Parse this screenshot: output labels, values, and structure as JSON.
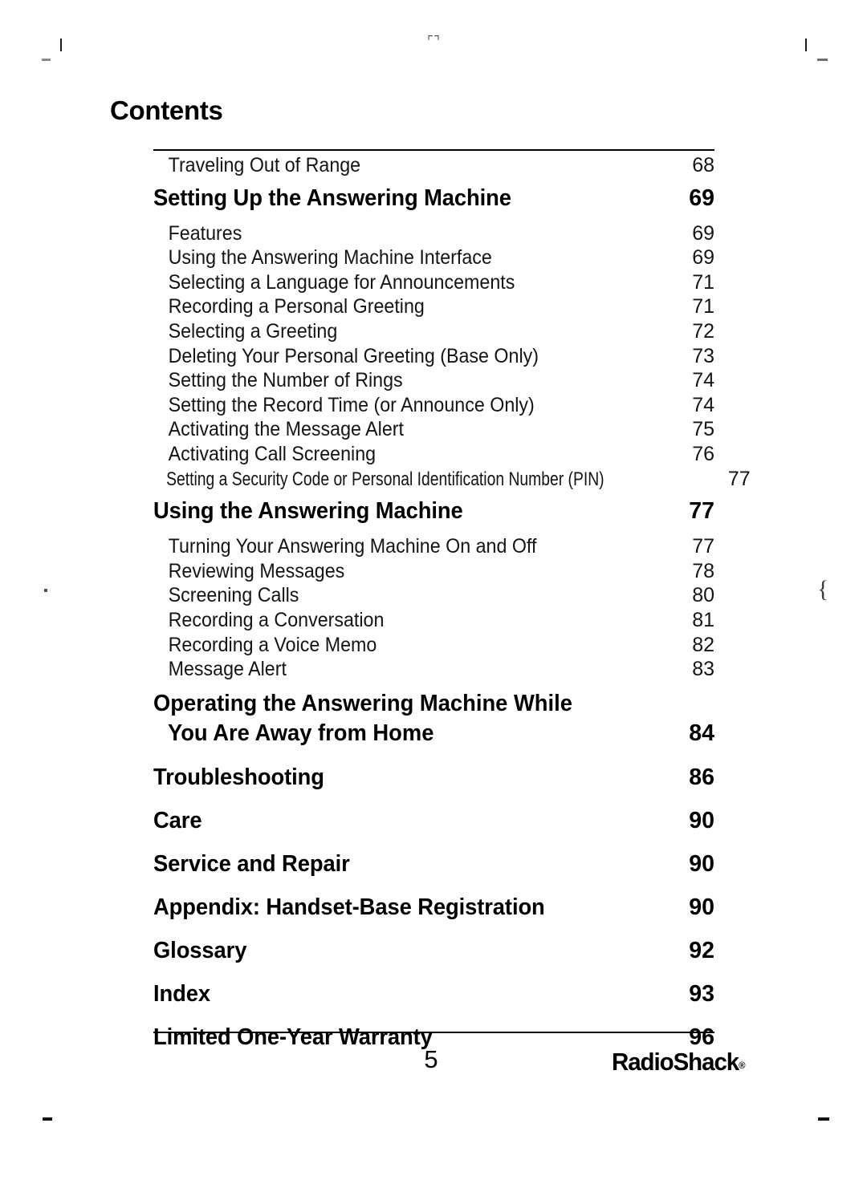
{
  "page": {
    "title": "Contents",
    "page_number": "5",
    "brand": "RadioShack",
    "brand_mark": "®"
  },
  "toc": {
    "entries": [
      {
        "kind": "sub",
        "label": "Traveling Out of Range",
        "page": "68"
      },
      {
        "kind": "head",
        "label": "Setting Up the Answering Machine",
        "page": "69"
      },
      {
        "kind": "sub",
        "label": "Features",
        "page": "69"
      },
      {
        "kind": "sub",
        "label": "Using the Answering Machine Interface",
        "page": "69"
      },
      {
        "kind": "sub",
        "label": "Selecting a Language for Announcements",
        "page": "71"
      },
      {
        "kind": "sub",
        "label": "Recording a Personal Greeting",
        "page": "71"
      },
      {
        "kind": "sub",
        "label": "Selecting a Greeting",
        "page": "72"
      },
      {
        "kind": "sub",
        "label": "Deleting Your Personal Greeting (Base Only)",
        "page": "73"
      },
      {
        "kind": "sub",
        "label": "Setting the Number of Rings",
        "page": "74"
      },
      {
        "kind": "sub",
        "label": "Setting the Record Time (or Announce Only)",
        "page": "74"
      },
      {
        "kind": "sub",
        "label": "Activating the Message Alert",
        "page": "75"
      },
      {
        "kind": "sub",
        "label": "Activating Call Screening",
        "page": "76"
      },
      {
        "kind": "sub-tight",
        "label": "Setting a Security Code or Personal Identification Number (PIN)",
        "page": "77"
      },
      {
        "kind": "head",
        "label": "Using the Answering Machine",
        "page": "77"
      },
      {
        "kind": "sub",
        "label": "Turning Your Answering Machine On and Off",
        "page": "77"
      },
      {
        "kind": "sub",
        "label": "Reviewing Messages",
        "page": "78"
      },
      {
        "kind": "sub",
        "label": "Screening Calls",
        "page": "80"
      },
      {
        "kind": "sub",
        "label": "Recording a Conversation",
        "page": "81"
      },
      {
        "kind": "sub",
        "label": "Recording a Voice Memo",
        "page": "82"
      },
      {
        "kind": "sub",
        "label": "Message Alert",
        "page": "83"
      },
      {
        "kind": "head2",
        "label_line1": "Operating the Answering Machine While",
        "label_line2": "You Are Away from Home",
        "page": "84"
      },
      {
        "kind": "head",
        "label": "Troubleshooting",
        "page": "86"
      },
      {
        "kind": "head",
        "label": "Care",
        "page": "90"
      },
      {
        "kind": "head",
        "label": "Service and Repair",
        "page": "90"
      },
      {
        "kind": "head",
        "label": "Appendix: Handset-Base Registration",
        "page": "90"
      },
      {
        "kind": "head",
        "label": "Glossary",
        "page": "92"
      },
      {
        "kind": "head",
        "label": "Index",
        "page": "93"
      },
      {
        "kind": "head",
        "label": "Limited One-Year Warranty",
        "page": "96"
      }
    ]
  }
}
